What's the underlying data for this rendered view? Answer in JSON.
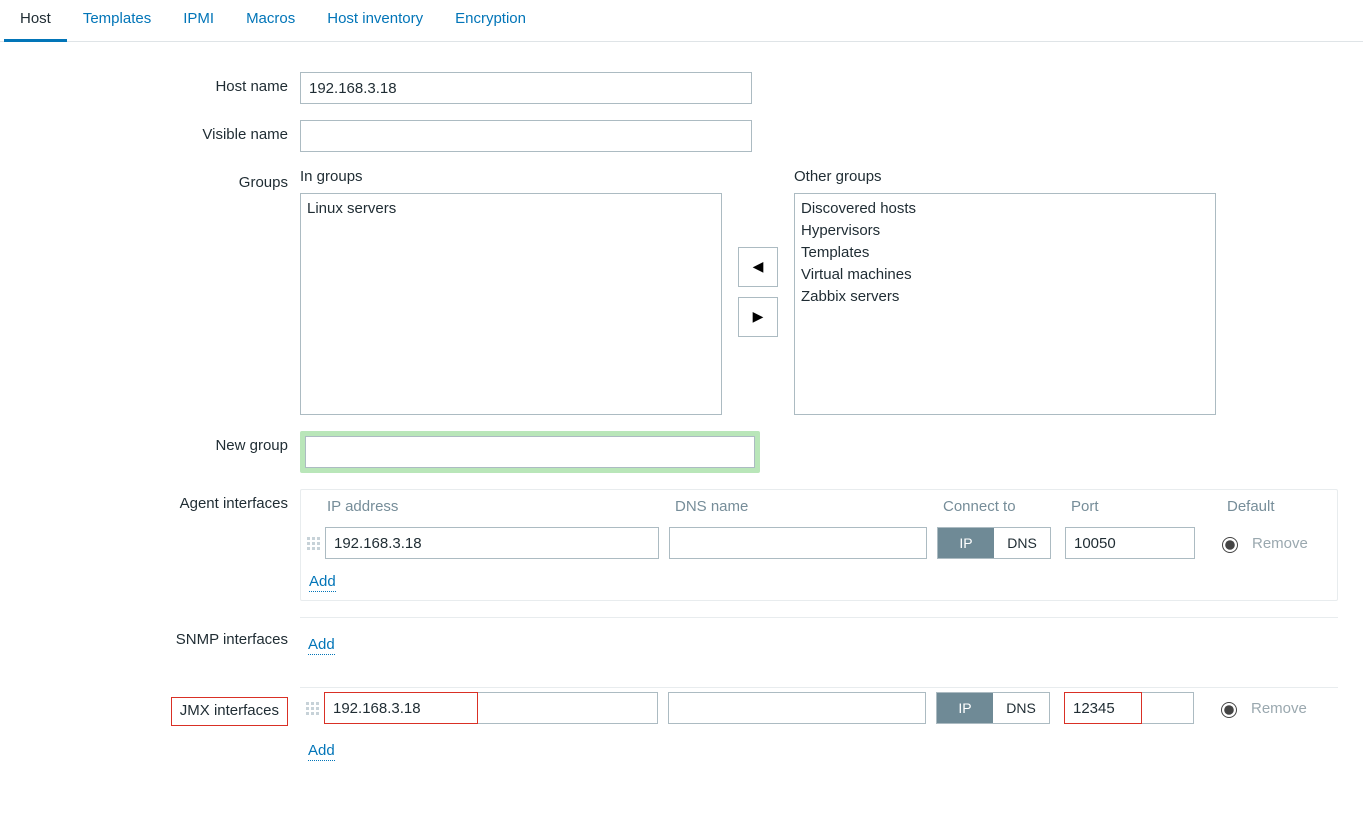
{
  "tabs": {
    "host": "Host",
    "templates": "Templates",
    "ipmi": "IPMI",
    "macros": "Macros",
    "inventory": "Host inventory",
    "encryption": "Encryption"
  },
  "labels": {
    "host_name": "Host name",
    "visible_name": "Visible name",
    "groups": "Groups",
    "in_groups": "In groups",
    "other_groups": "Other groups",
    "new_group": "New group",
    "agent_interfaces": "Agent interfaces",
    "snmp_interfaces": "SNMP interfaces",
    "jmx_interfaces": "JMX interfaces"
  },
  "fields": {
    "host_name": "192.168.3.18",
    "visible_name": "",
    "new_group": ""
  },
  "groups": {
    "in": [
      "Linux servers"
    ],
    "other": [
      "Discovered hosts",
      "Hypervisors",
      "Templates",
      "Virtual machines",
      "Zabbix servers"
    ]
  },
  "iface_headers": {
    "ip": "IP address",
    "dns": "DNS name",
    "connect": "Connect to",
    "port": "Port",
    "default": "Default"
  },
  "connect_opts": {
    "ip": "IP",
    "dns": "DNS"
  },
  "agent": {
    "ip": "192.168.3.18",
    "dns": "",
    "port": "10050"
  },
  "jmx": {
    "ip": "192.168.3.18",
    "dns": "",
    "port": "12345"
  },
  "actions": {
    "add": "Add",
    "remove": "Remove"
  }
}
